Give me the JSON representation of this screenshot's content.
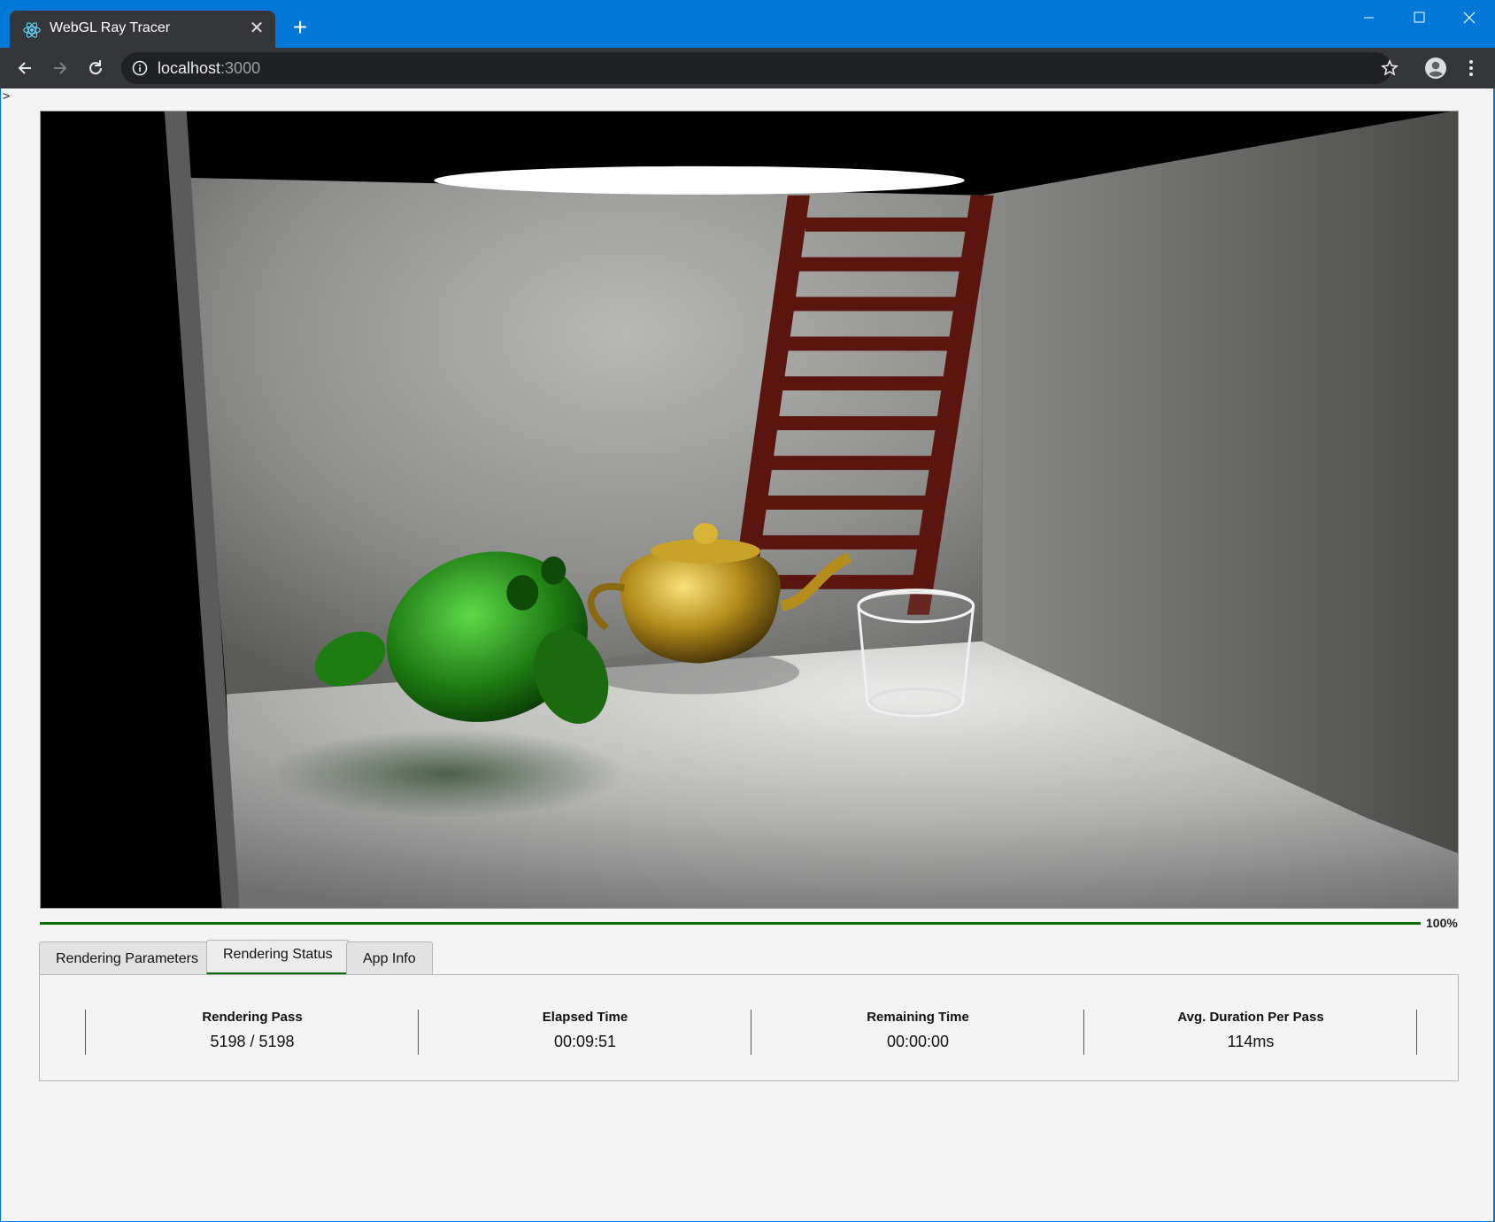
{
  "browser": {
    "tab_title": "WebGL Ray Tracer",
    "tab_close": "✕",
    "new_tab": "+",
    "url_host": "localhost",
    "url_port": ":3000",
    "icons": [
      "react-favicon-icon",
      "back-icon",
      "forward-icon",
      "reload-icon",
      "info-icon",
      "star-icon",
      "profile-icon",
      "menu-icon",
      "minimize-icon",
      "maximize-icon",
      "close-icon"
    ]
  },
  "page": {
    "stray_text": ">",
    "progress": {
      "value": 1.0,
      "label": "100%",
      "color": "#0b6b0b"
    },
    "tabs": [
      {
        "label": "Rendering Parameters",
        "active": false
      },
      {
        "label": "Rendering Status",
        "active": true
      },
      {
        "label": "App Info",
        "active": false
      }
    ],
    "status": [
      {
        "label": "Rendering Pass",
        "value": "5198 / 5198"
      },
      {
        "label": "Elapsed Time",
        "value": "00:09:51"
      },
      {
        "label": "Remaining Time",
        "value": "00:00:00"
      },
      {
        "label": "Avg. Duration Per Pass",
        "value": "114ms"
      }
    ]
  },
  "colors": {
    "titlebar": "#0078d7",
    "toolbar": "#35363a",
    "accent": "#0b6b0b"
  }
}
